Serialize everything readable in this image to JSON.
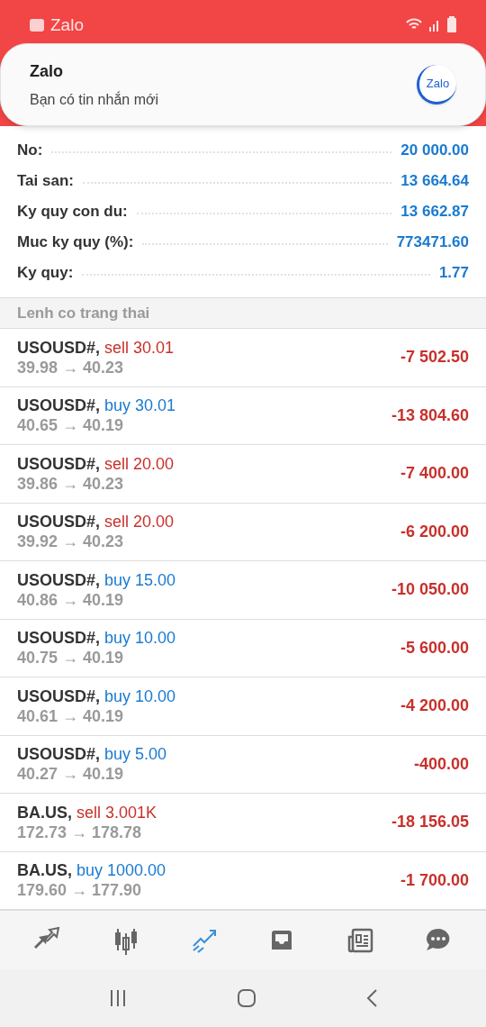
{
  "status_bar": {
    "app": "Zalo"
  },
  "notification": {
    "title": "Zalo",
    "message": "Bạn có tin nhắn mới",
    "logo": "Zalo"
  },
  "summary": [
    {
      "label": "No:",
      "value": "20 000.00"
    },
    {
      "label": "Tai san:",
      "value": "13 664.64"
    },
    {
      "label": "Ky quy con du:",
      "value": "13 662.87"
    },
    {
      "label": "Muc ky quy (%):",
      "value": "773471.60"
    },
    {
      "label": "Ky quy:",
      "value": "1.77"
    }
  ],
  "section_title": "Lenh co trang thai",
  "orders": [
    {
      "symbol": "USOUSD#,",
      "kind": "sell",
      "trade": "sell 30.01",
      "prices": "39.98 → 40.23",
      "profit": "-7 502.50"
    },
    {
      "symbol": "USOUSD#,",
      "kind": "buy",
      "trade": "buy 30.01",
      "prices": "40.65 → 40.19",
      "profit": "-13 804.60"
    },
    {
      "symbol": "USOUSD#,",
      "kind": "sell",
      "trade": "sell 20.00",
      "prices": "39.86 → 40.23",
      "profit": "-7 400.00"
    },
    {
      "symbol": "USOUSD#,",
      "kind": "sell",
      "trade": "sell 20.00",
      "prices": "39.92 → 40.23",
      "profit": "-6 200.00"
    },
    {
      "symbol": "USOUSD#,",
      "kind": "buy",
      "trade": "buy 15.00",
      "prices": "40.86 → 40.19",
      "profit": "-10 050.00"
    },
    {
      "symbol": "USOUSD#,",
      "kind": "buy",
      "trade": "buy 10.00",
      "prices": "40.75 → 40.19",
      "profit": "-5 600.00"
    },
    {
      "symbol": "USOUSD#,",
      "kind": "buy",
      "trade": "buy 10.00",
      "prices": "40.61 → 40.19",
      "profit": "-4 200.00"
    },
    {
      "symbol": "USOUSD#,",
      "kind": "buy",
      "trade": "buy 5.00",
      "prices": "40.27 → 40.19",
      "profit": "-400.00"
    },
    {
      "symbol": "BA.US,",
      "kind": "sell",
      "trade": "sell 3.001K",
      "prices": "172.73 → 178.78",
      "profit": "-18 156.05"
    },
    {
      "symbol": "BA.US,",
      "kind": "buy",
      "trade": "buy 1000.00",
      "prices": "179.60 → 177.90",
      "profit": "-1 700.00"
    }
  ],
  "bottom_nav": [
    {
      "kind": "quotes",
      "selected": false
    },
    {
      "kind": "chart",
      "selected": false
    },
    {
      "kind": "trade",
      "selected": true
    },
    {
      "kind": "history",
      "selected": false
    },
    {
      "kind": "news",
      "selected": false
    },
    {
      "kind": "chat",
      "selected": false
    }
  ]
}
